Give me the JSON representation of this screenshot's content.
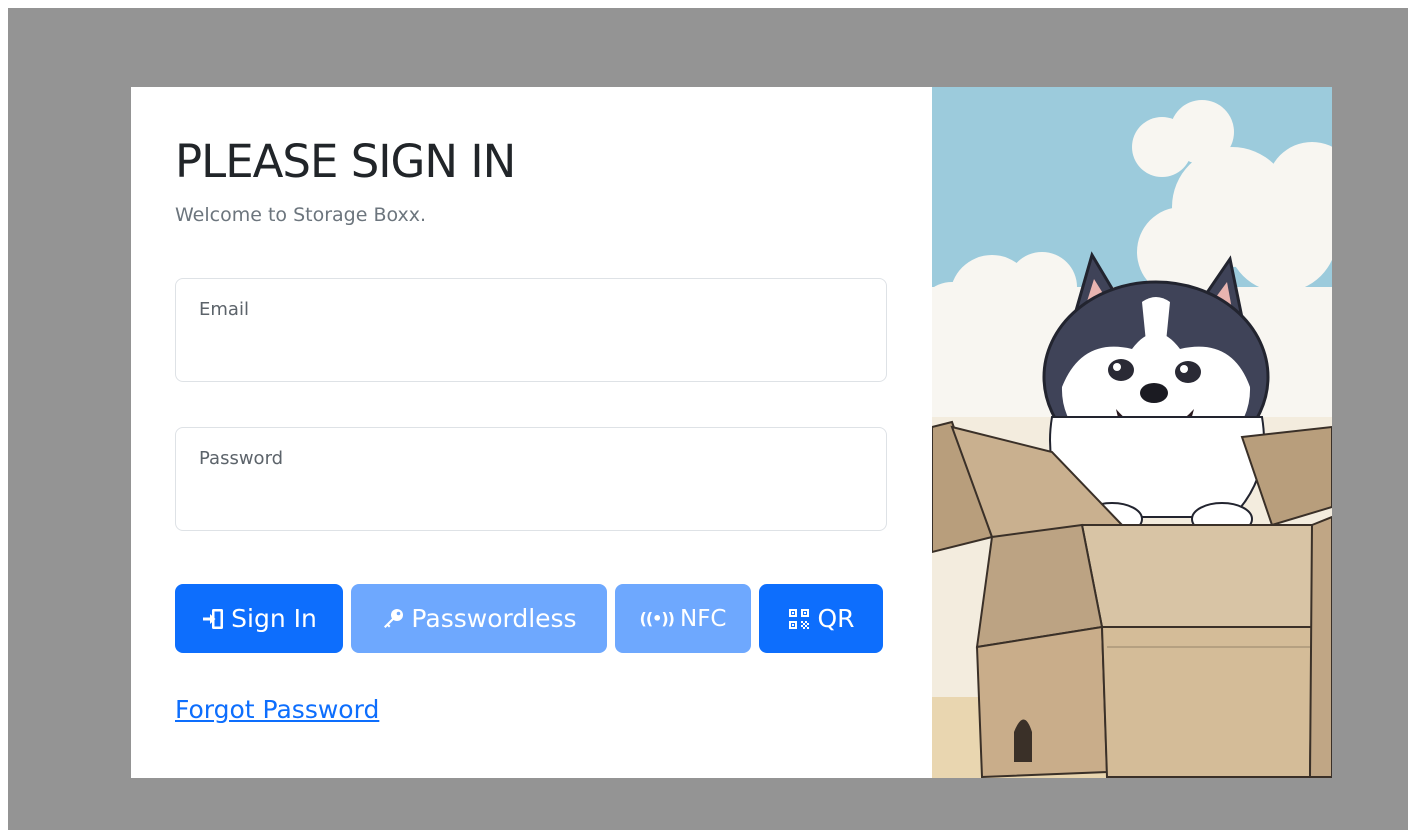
{
  "login": {
    "title": "PLEASE SIGN IN",
    "subtitle": "Welcome to Storage Boxx.",
    "email_label": "Email",
    "email_value": "",
    "password_label": "Password",
    "password_value": "",
    "buttons": {
      "signin": "Sign In",
      "passwordless": "Passwordless",
      "nfc": "NFC",
      "qr": "QR"
    },
    "forgot_link": "Forgot Password"
  },
  "illustration": {
    "subject": "husky puppy in cardboard box"
  },
  "colors": {
    "overlay": "#949494",
    "primary": "#0d6efd",
    "primary_muted": "#6ea8fe",
    "sky": "#9ccbdc",
    "box": "#c4ad8c"
  },
  "icons": {
    "signin": "sign-in-icon",
    "passwordless": "key-icon",
    "nfc": "nfc-icon",
    "qr": "qr-code-icon"
  }
}
